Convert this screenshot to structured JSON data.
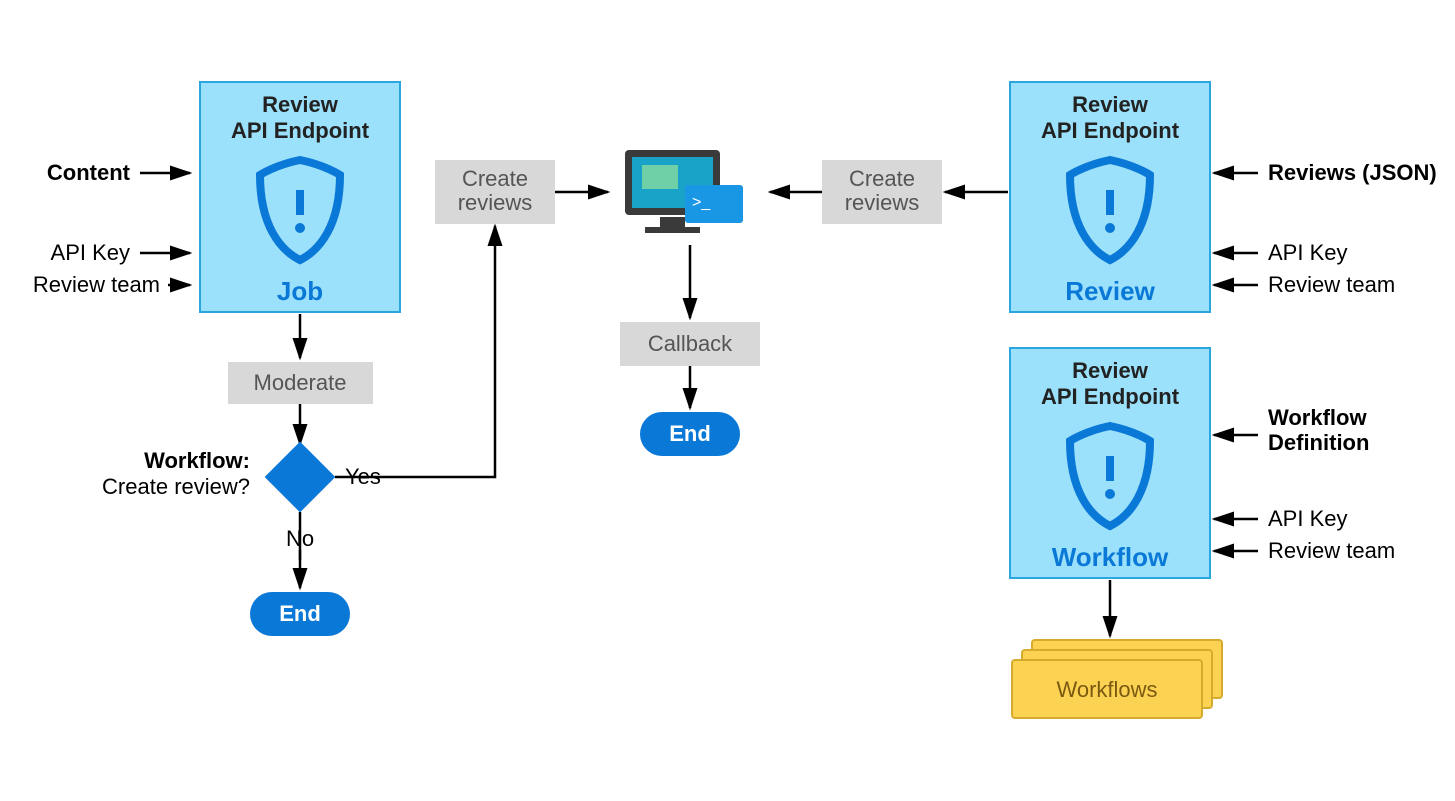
{
  "inputs": {
    "content": "Content",
    "api_key": "API Key",
    "review_team": "Review team",
    "reviews_json": "Reviews (JSON)",
    "workflow_def1": "Workflow",
    "workflow_def2": "Definition"
  },
  "endpoints": {
    "title1": "Review",
    "title2": "API Endpoint",
    "job": "Job",
    "review": "Review",
    "workflow": "Workflow"
  },
  "steps": {
    "moderate": "Moderate",
    "create_reviews": "Create",
    "create_reviews2": "reviews",
    "callback": "Callback",
    "end": "End"
  },
  "decision": {
    "title": "Workflow:",
    "question": "Create review?",
    "yes": "Yes",
    "no": "No"
  },
  "workflows_stack": "Workflows",
  "icons": {
    "shield": "shield-icon",
    "monitor": "monitor-icon"
  }
}
